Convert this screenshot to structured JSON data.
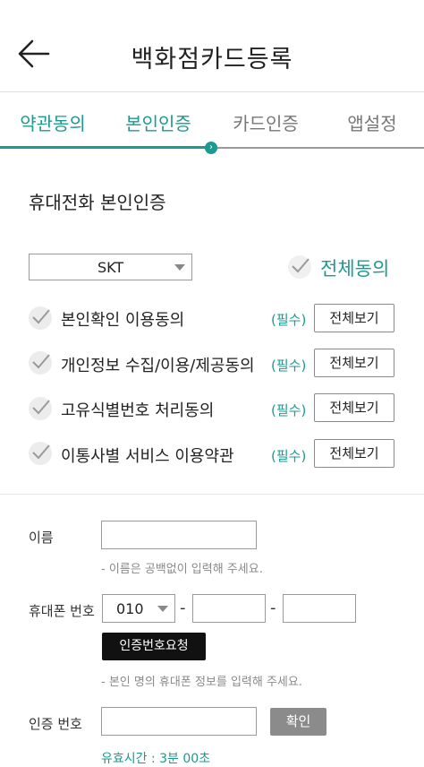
{
  "header": {
    "title": "백화점카드등록",
    "back_icon": "arrow-left-icon"
  },
  "steps": [
    {
      "label": "약관동의",
      "state": "done"
    },
    {
      "label": "본인인증",
      "state": "active"
    },
    {
      "label": "카드인증",
      "state": "todo"
    },
    {
      "label": "앱설정",
      "state": "todo"
    }
  ],
  "step_marker": "›",
  "section_title": "휴대전화 본인인증",
  "carrier": {
    "selected": "SKT"
  },
  "agree_all": {
    "label": "전체동의",
    "checked": true
  },
  "terms": [
    {
      "label": "본인확인 이용동의",
      "required": "(필수)",
      "view": "전체보기"
    },
    {
      "label": "개인정보 수집/이용/제공동의",
      "required": "(필수)",
      "view": "전체보기"
    },
    {
      "label": "고유식별번호 처리동의",
      "required": "(필수)",
      "view": "전체보기"
    },
    {
      "label": "이통사별 서비스 이용약관",
      "required": "(필수)",
      "view": "전체보기"
    }
  ],
  "form": {
    "name_label": "이름",
    "name_value": "",
    "name_hint": "- 이름은 공백없이 입력해 주세요.",
    "phone_label": "휴대폰 번호",
    "phone_prefix": "010",
    "phone_dash": "-",
    "request_button": "인증번호요청",
    "phone_hint": "- 본인 명의 휴대폰 정보를 입력해 주세요.",
    "code_label": "인증 번호",
    "confirm_button": "확인",
    "timer_text": "유효시간 : 3분 00초"
  },
  "colors": {
    "accent": "#1b9a8f",
    "check_bg": "#ececec",
    "dark_button": "#111111",
    "gray_button": "#8b8b8b"
  }
}
